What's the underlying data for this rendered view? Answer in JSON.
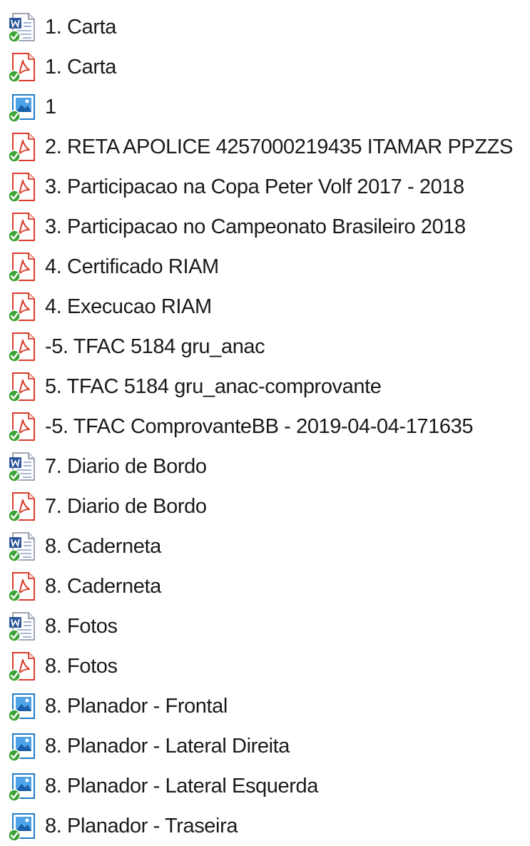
{
  "files": [
    {
      "name": "1. Carta",
      "icon": "word-document-icon"
    },
    {
      "name": "1. Carta",
      "icon": "pdf-document-icon"
    },
    {
      "name": "1",
      "icon": "image-file-icon"
    },
    {
      "name": "2. RETA APOLICE 4257000219435 ITAMAR PPZZS",
      "icon": "pdf-document-icon"
    },
    {
      "name": "3. Participacao na Copa Peter Volf 2017 - 2018",
      "icon": "pdf-document-icon"
    },
    {
      "name": "3. Participacao no Campeonato Brasileiro 2018",
      "icon": "pdf-document-icon"
    },
    {
      "name": "4. Certificado RIAM",
      "icon": "pdf-document-icon"
    },
    {
      "name": "4. Execucao RIAM",
      "icon": "pdf-document-icon"
    },
    {
      "name": "-5. TFAC 5184 gru_anac",
      "icon": "pdf-document-icon"
    },
    {
      "name": "5. TFAC 5184 gru_anac-comprovante",
      "icon": "pdf-document-icon"
    },
    {
      "name": "-5. TFAC ComprovanteBB - 2019-04-04-171635",
      "icon": "pdf-document-icon"
    },
    {
      "name": "7. Diario de Bordo",
      "icon": "word-document-icon"
    },
    {
      "name": "7. Diario de Bordo",
      "icon": "pdf-document-icon"
    },
    {
      "name": "8. Caderneta",
      "icon": "word-document-icon"
    },
    {
      "name": "8. Caderneta",
      "icon": "pdf-document-icon"
    },
    {
      "name": "8. Fotos",
      "icon": "word-document-icon"
    },
    {
      "name": "8. Fotos",
      "icon": "pdf-document-icon"
    },
    {
      "name": "8. Planador - Frontal",
      "icon": "image-file-icon"
    },
    {
      "name": "8. Planador - Lateral Direita",
      "icon": "image-file-icon"
    },
    {
      "name": "8. Planador - Lateral Esquerda",
      "icon": "image-file-icon"
    },
    {
      "name": "8. Planador - Traseira",
      "icon": "image-file-icon"
    }
  ],
  "colors": {
    "pdf_accent": "#d93b2b",
    "word_accent": "#2b579a",
    "image_accent": "#1e7bc8",
    "sync_check": "#3aa335"
  }
}
